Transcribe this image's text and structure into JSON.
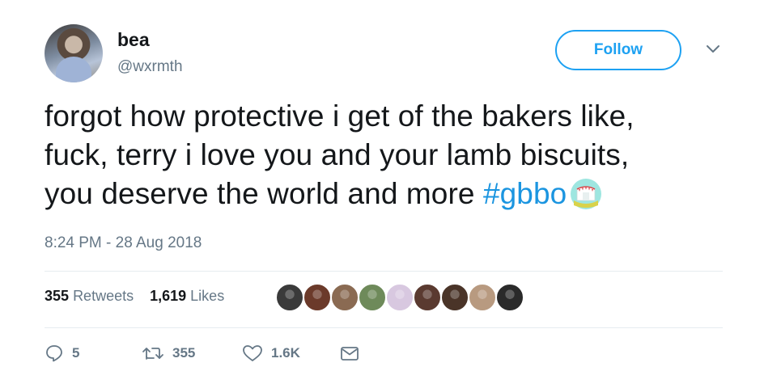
{
  "user": {
    "display_name": "bea",
    "handle": "@wxrmth",
    "follow_label": "Follow"
  },
  "tweet": {
    "lines": [
      "forgot how protective i get of the bakers like,",
      "fuck, terry i love you and your lamb biscuits,",
      "you deserve the world and more "
    ],
    "hashtag": "#gbbo",
    "hashtag_emoji": "gbbo-tent-emoji",
    "timestamp": "8:24 PM - 28 Aug 2018"
  },
  "stats": {
    "retweets_count": "355",
    "retweets_label": "Retweets",
    "likes_count": "1,619",
    "likes_label": "Likes"
  },
  "likers": [
    {
      "color": "#3a3a3a"
    },
    {
      "color": "#6b3a2a"
    },
    {
      "color": "#8a6a52"
    },
    {
      "color": "#6e8a5a"
    },
    {
      "color": "#d8c8e0"
    },
    {
      "color": "#5a3a30"
    },
    {
      "color": "#4a3428"
    },
    {
      "color": "#b89a80"
    },
    {
      "color": "#2a2a2a"
    }
  ],
  "actions": {
    "reply_count": "5",
    "retweet_count": "355",
    "like_count": "1.6K"
  },
  "colors": {
    "accent": "#1da1f2",
    "hashtag": "#1b95e0",
    "muted": "#657786",
    "text": "#14171a"
  }
}
